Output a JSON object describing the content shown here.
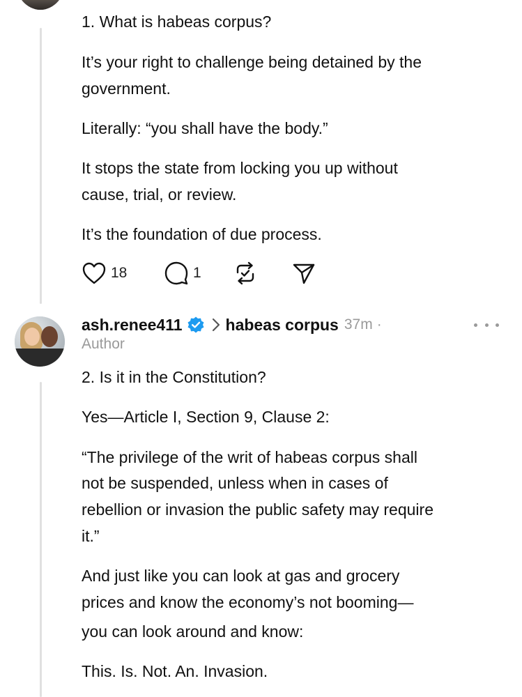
{
  "post1": {
    "paragraphs": [
      "1. What is habeas corpus?",
      "It’s your right to challenge being detained by the",
      "government.",
      "Literally: “you shall have the body.”",
      "It stops the state from locking you up without",
      "cause, trial, or review.",
      "It’s the foundation of due process."
    ],
    "actions": {
      "like_icon": "heart-icon",
      "like_count": "18",
      "reply_icon": "comment-icon",
      "reply_count": "1",
      "repost_icon": "repost-icon",
      "share_icon": "send-icon"
    }
  },
  "post2": {
    "username": "ash.renee411",
    "verified_icon": "verified-badge-icon",
    "verified_color": "#1d9bf0",
    "topic": "habeas corpus",
    "time": "37m",
    "separator": "·",
    "author_label": "Author",
    "more_icon": "more-options-icon",
    "lines": [
      "2. Is it in the Constitution?",
      "Yes—Article I, Section 9, Clause 2:",
      "“The privilege of the writ of habeas corpus shall",
      "not be suspended, unless when in cases of",
      "rebellion or invasion the public safety may require",
      "it.”",
      "And just like you can look at gas and grocery",
      "prices and know the economy’s not booming—",
      "you can look around and know:",
      "This. Is. Not. An. Invasion."
    ]
  }
}
